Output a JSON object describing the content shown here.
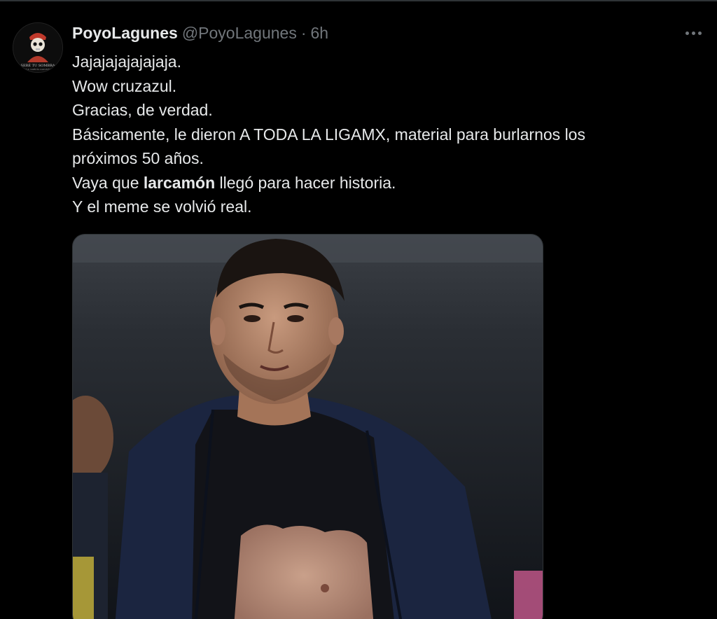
{
  "tweet": {
    "display_name": "PoyoLagunes",
    "handle": "@PoyoLagunes",
    "separator": "·",
    "time": "6h",
    "lines": [
      "Jajajajajajajaja.",
      "Wow cruzazul.",
      "Gracias, de verdad.",
      "Básicamente, le dieron A TODA LA LIGAMX, material para burlarnos los",
      "próximos 50 años."
    ],
    "line6_prefix": "Vaya que ",
    "line6_bold": "larcamón",
    "line6_suffix": " llegó para hacer historia.",
    "line7": "Y el meme se volvió real.",
    "avatar_text": "SERÉ TU SOMBRA",
    "avatar_subtext": "M.A. GARCÍA LAGUNES",
    "more_icon": "more-horizontal-icon"
  },
  "colors": {
    "background": "#000000",
    "text_primary": "#e7e9ea",
    "text_secondary": "#71767b",
    "border": "#2f3336"
  }
}
